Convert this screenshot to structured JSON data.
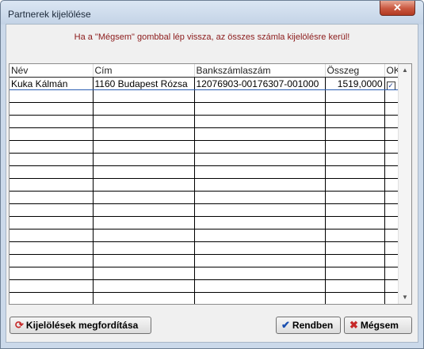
{
  "window": {
    "title": "Partnerek kijelölése",
    "close_glyph": "✕"
  },
  "warning": "Ha a \"Mégsem\" gombbal lép vissza, az összes számla kijelölésre kerül!",
  "grid": {
    "headers": {
      "name": "Név",
      "address": "Cím",
      "account": "Bankszámlaszám",
      "amount": "Összeg",
      "ok": "OK"
    },
    "rows": [
      {
        "name": "Kuka Kálmán",
        "address": "1160 Budapest Rózsa",
        "account": "12076903-00176307-001000",
        "amount": "1519,0000",
        "ok": true
      }
    ],
    "empty_row_count": 17
  },
  "buttons": {
    "invert": {
      "label": "Kijelölések megfordítása",
      "icon": "refresh-icon"
    },
    "ok": {
      "label": "Rendben",
      "icon": "check-icon"
    },
    "cancel": {
      "label": "Mégsem",
      "icon": "x-icon"
    }
  },
  "colors": {
    "warning": "#8b1a1a",
    "check": "#1a3a8a",
    "cancel_x": "#c62828",
    "refresh": "#c62828"
  }
}
